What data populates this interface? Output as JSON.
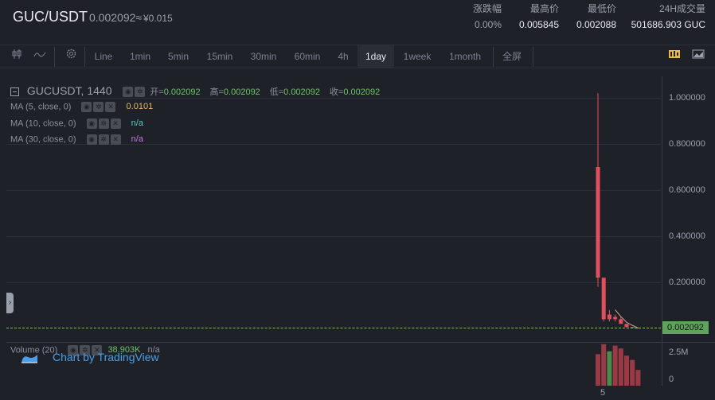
{
  "header": {
    "pair": "GUC/USDT",
    "price": "0.002092≈",
    "price_cny": "¥0.015",
    "stats": [
      {
        "label": "涨跌幅",
        "value": "0.00%"
      },
      {
        "label": "最高价",
        "value": "0.005845"
      },
      {
        "label": "最低价",
        "value": "0.002088"
      },
      {
        "label": "24H成交量",
        "value": "501686.903 GUC"
      }
    ]
  },
  "toolbar": {
    "items": [
      "Line",
      "1min",
      "5min",
      "15min",
      "30min",
      "60min",
      "4h",
      "1day",
      "1week",
      "1month",
      "全屏"
    ],
    "active": "1day"
  },
  "legend": {
    "symbol": "GUCUSDT, 1440",
    "ohlc": [
      {
        "label": "开=",
        "value": "0.002092"
      },
      {
        "label": "高=",
        "value": "0.002092"
      },
      {
        "label": "低=",
        "value": "0.002092"
      },
      {
        "label": "收=",
        "value": "0.002092"
      }
    ],
    "ma": [
      {
        "label": "MA (5, close, 0)",
        "value": "0.0101",
        "color": "#e8b86a"
      },
      {
        "label": "MA (10, close, 0)",
        "value": "n/a",
        "color": "#5ec8c1"
      },
      {
        "label": "MA (30, close, 0)",
        "value": "n/a",
        "color": "#c27be0"
      }
    ],
    "volume_label": "Volume (20)",
    "volume_value": "38.903K",
    "volume_ma": "n/a"
  },
  "branding": "Chart by TradingView",
  "price_axis": [
    "1.000000",
    "0.800000",
    "0.600000",
    "0.400000",
    "0.200000"
  ],
  "last_price_tag": "0.002092",
  "volume_axis": [
    "2.5M",
    "0"
  ],
  "x_axis_tick": "5",
  "colors": {
    "up": "#5fa35d",
    "down": "#e0505d",
    "bg": "#1f2129",
    "accent": "#e8b84a"
  },
  "chart_data": {
    "type": "candlestick",
    "price_axis_range": [
      0,
      1.0
    ],
    "candles": [
      {
        "open": 0.7,
        "high": 1.02,
        "low": 0.18,
        "close": 0.22
      },
      {
        "open": 0.22,
        "high": 0.22,
        "low": 0.03,
        "close": 0.04
      },
      {
        "open": 0.06,
        "high": 0.08,
        "low": 0.03,
        "close": 0.04
      },
      {
        "open": 0.05,
        "high": 0.06,
        "low": 0.03,
        "close": 0.04
      },
      {
        "open": 0.04,
        "high": 0.05,
        "low": 0.02,
        "close": 0.02
      },
      {
        "open": 0.02,
        "high": 0.02,
        "low": 0.005,
        "close": 0.006
      },
      {
        "open": 0.006,
        "high": 0.006,
        "low": 0.002,
        "close": 0.003
      },
      {
        "open": 0.003,
        "high": 0.003,
        "low": 0.002,
        "close": 0.002092
      }
    ],
    "volume_axis_range": [
      0,
      3.0
    ],
    "volumes_millions": [
      2.2,
      2.9,
      2.4,
      2.8,
      2.6,
      2.1,
      1.8,
      1.1
    ],
    "volume_colors": [
      "down",
      "down",
      "up",
      "down",
      "down",
      "down",
      "down",
      "down"
    ]
  }
}
